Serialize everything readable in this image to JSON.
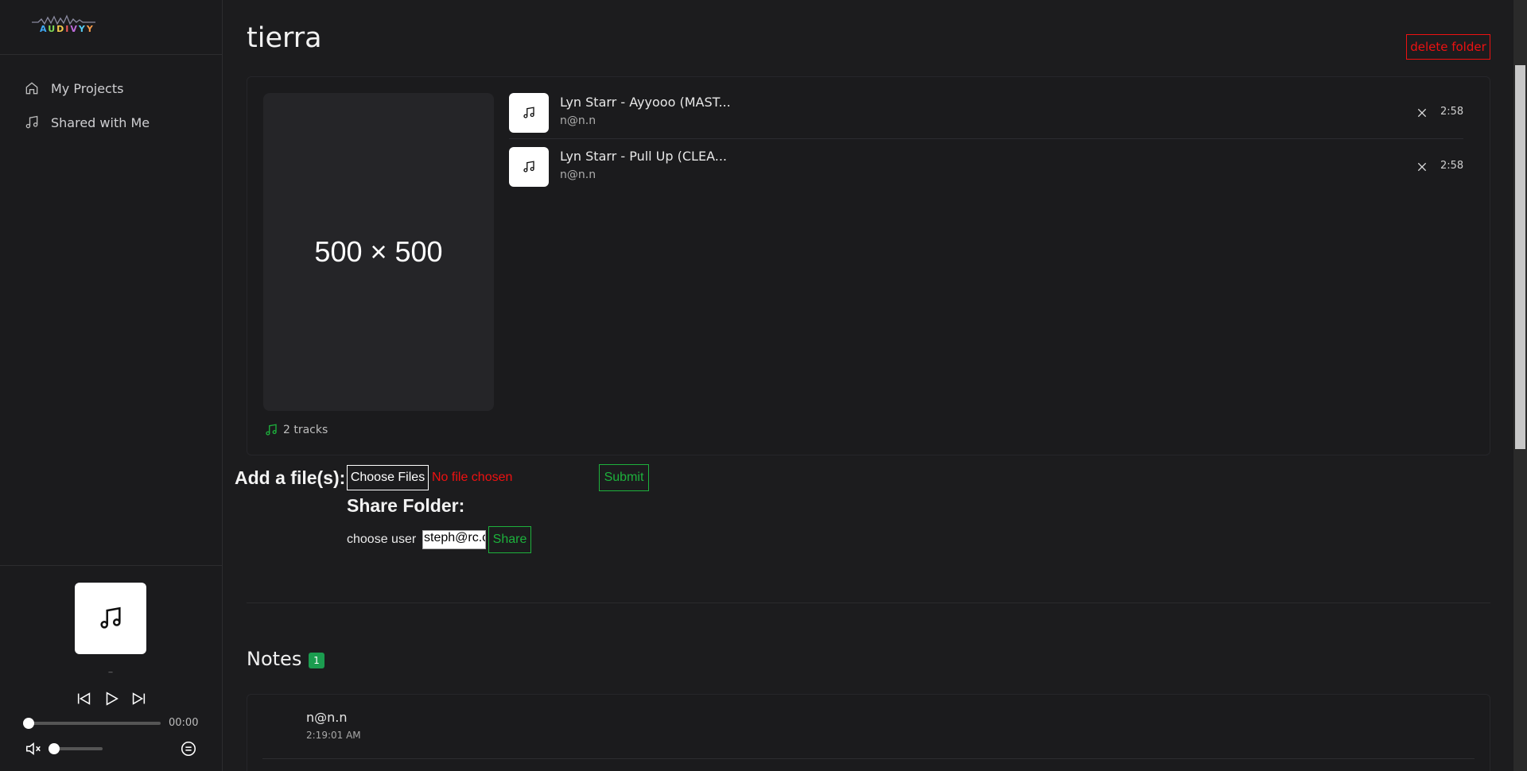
{
  "sidebar": {
    "logo_text": [
      "A",
      "U",
      "D",
      "I",
      "V",
      "Y",
      "Y"
    ],
    "items": [
      {
        "label": "My Projects",
        "icon": "home-icon"
      },
      {
        "label": "Shared with Me",
        "icon": "music-note-icon"
      }
    ]
  },
  "player": {
    "art_caption": "_",
    "time": "00:00",
    "progress": 0,
    "volume": 0.05
  },
  "folder": {
    "title": "tierra",
    "delete_label": "delete folder",
    "cover_label": "500 × 500",
    "tracks_count": "2 tracks",
    "tracks": [
      {
        "title": "Lyn Starr - Ayyooo (MAST...",
        "artist": "n@n.n",
        "duration": "2:58"
      },
      {
        "title": "Lyn Starr - Pull Up (CLEA...",
        "artist": "n@n.n",
        "duration": "2:58"
      }
    ]
  },
  "upload": {
    "label": "Add a file(s):",
    "choose_label": "Choose Files",
    "no_file": "No file chosen",
    "submit_label": "Submit"
  },
  "share": {
    "title": "Share Folder:",
    "choose_user_label": "choose user",
    "user_value": "steph@rc.c",
    "share_label": "Share"
  },
  "notes": {
    "title": "Notes",
    "count": "1",
    "items": [
      {
        "author": "n@n.n",
        "time": "2:19:01 AM"
      }
    ]
  },
  "colors": {
    "accent_green": "#1db13c",
    "danger_red": "#e11111",
    "badge_green": "#1b9c4f"
  }
}
